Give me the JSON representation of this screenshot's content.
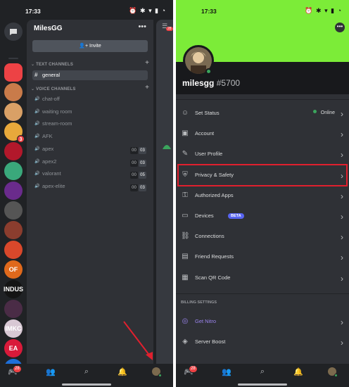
{
  "status_bar": {
    "left_time": "17:33",
    "right_time": "17:33",
    "icons_text": "⏰ ✱ ▾ ▮ ◔"
  },
  "left": {
    "server": {
      "name": "MilesGG",
      "menu_glyph": "•••",
      "invite_label": "Invite"
    },
    "text_channels_label": "TEXT CHANNELS",
    "voice_channels_label": "VOICE CHANNELS",
    "text_channels": [
      {
        "name": "general",
        "active": true
      }
    ],
    "voice_channels": [
      {
        "name": "chat-off",
        "counts": []
      },
      {
        "name": "waiting room",
        "counts": []
      },
      {
        "name": "stream-room",
        "counts": []
      },
      {
        "name": "AFK",
        "counts": []
      },
      {
        "name": "apex",
        "counts": [
          "00",
          "03"
        ]
      },
      {
        "name": "apex2",
        "counts": [
          "00",
          "03"
        ]
      },
      {
        "name": "valorant",
        "counts": [
          "00",
          "05"
        ]
      },
      {
        "name": "apex-elite",
        "counts": [
          "00",
          "03"
        ]
      }
    ],
    "guilds": [
      {
        "label": "",
        "color": "#ed4245",
        "badge": ""
      },
      {
        "label": "",
        "color": "#c97b4a",
        "badge": ""
      },
      {
        "label": "",
        "color": "#d9a066",
        "badge": ""
      },
      {
        "label": "",
        "color": "#e8a93b",
        "badge": "3"
      },
      {
        "label": "",
        "color": "#b2182b",
        "badge": ""
      },
      {
        "label": "",
        "color": "#3aa87b",
        "badge": ""
      },
      {
        "label": "",
        "color": "#6a2b8c",
        "badge": ""
      },
      {
        "label": "",
        "color": "#555555",
        "badge": ""
      },
      {
        "label": "",
        "color": "#8b3d2e",
        "badge": ""
      },
      {
        "label": "",
        "color": "#d9482b",
        "badge": ""
      },
      {
        "label": "OF",
        "color": "#e0691c",
        "badge": ""
      },
      {
        "label": "INDUS",
        "color": "#141414",
        "badge": ""
      },
      {
        "label": "",
        "color": "#4a2c46",
        "badge": ""
      },
      {
        "label": "IMKC",
        "color": "#d8c8d4",
        "badge": ""
      },
      {
        "label": "EA",
        "color": "#d91a3a",
        "badge": ""
      },
      {
        "label": "",
        "color": "#1e6fd9",
        "badge": ""
      },
      {
        "label": "",
        "color": "#b59042",
        "badge": ""
      }
    ],
    "nav_badge": "28"
  },
  "right": {
    "profile": {
      "username": "milesgg",
      "discriminator": "#5700",
      "banner_color": "#7cec38"
    },
    "banner_menu_glyph": "•••",
    "settings": [
      {
        "label": "Set Status",
        "icon": "smiley-icon",
        "status": "Online"
      },
      {
        "label": "Account",
        "icon": "account-icon"
      },
      {
        "label": "User Profile",
        "icon": "pencil-icon"
      },
      {
        "label": "Privacy & Safety",
        "icon": "shield-icon"
      },
      {
        "label": "Authorized Apps",
        "icon": "key-icon"
      },
      {
        "label": "Devices",
        "icon": "monitor-icon",
        "badge": "BETA"
      },
      {
        "label": "Connections",
        "icon": "link-icon"
      },
      {
        "label": "Friend Requests",
        "icon": "friend-request-icon"
      },
      {
        "label": "Scan QR Code",
        "icon": "qr-code-icon"
      }
    ],
    "billing_label": "BILLING SETTINGS",
    "billing": [
      {
        "label": "Get Nitro",
        "icon": "nitro-icon"
      },
      {
        "label": "Server Boost",
        "icon": "boost-icon"
      }
    ],
    "nav_badge": "28",
    "highlight_color": "#e0202e"
  }
}
